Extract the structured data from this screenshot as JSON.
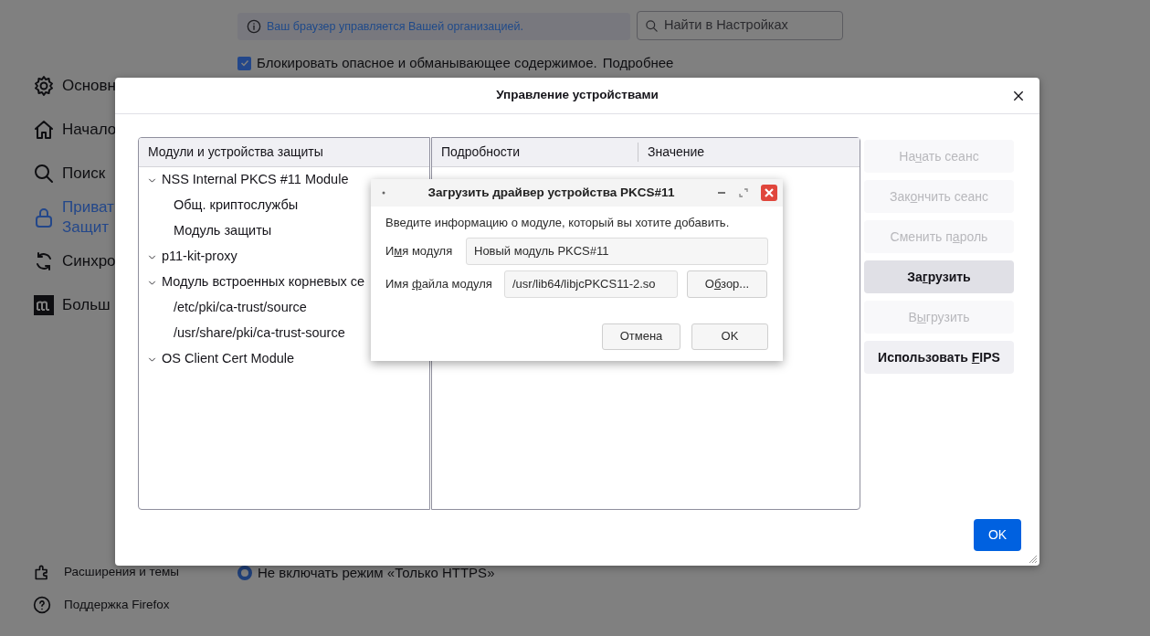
{
  "settings_page": {
    "sidebar": {
      "items": [
        {
          "lines": [
            "Основн"
          ],
          "selected": false
        },
        {
          "lines": [
            "Начало"
          ],
          "selected": false
        },
        {
          "lines": [
            "Поиск"
          ],
          "selected": false
        },
        {
          "lines": [
            "Приват",
            "Защит"
          ],
          "selected": true
        },
        {
          "lines": [
            "Синхро"
          ],
          "selected": false
        },
        {
          "lines": [
            "Больш"
          ],
          "selected": false
        }
      ],
      "footer": [
        {
          "label": "Расширения и темы"
        },
        {
          "label": "Поддержка Firefox"
        }
      ]
    },
    "policy_notice": "Ваш браузер управляется Вашей организацией.",
    "search": {
      "placeholder": "Найти в Настройках"
    },
    "block_option": {
      "checked": true,
      "label": "Блокировать опасное и обманывающее содержимое.",
      "link": "Подробнее"
    },
    "https_option": {
      "selected": true,
      "label": "Не включать режим «Только HTTPS»"
    }
  },
  "device_manager": {
    "title": "Управление устройствами",
    "tree_header": "Модули и устройства защиты",
    "modules": [
      {
        "label": "NSS Internal PKCS #11 Module",
        "expanded": true,
        "children": [
          {
            "label": "Общ. криптослужбы"
          },
          {
            "label": "Модуль защиты"
          }
        ]
      },
      {
        "label": "p11-kit-proxy",
        "expanded": true
      },
      {
        "label": "Модуль встроенных корневых се",
        "expanded": true,
        "children": [
          {
            "label": "/etc/pki/ca-trust/source"
          },
          {
            "label": "/usr/share/pki/ca-trust-source"
          }
        ]
      },
      {
        "label": "OS Client Cert Module",
        "expanded": true
      }
    ],
    "details_columns": [
      "Подробности",
      "Значение"
    ],
    "actions": [
      {
        "label_parts": [
          "На",
          "ч",
          "ать сеанс"
        ],
        "disabled": true,
        "hovered": false
      },
      {
        "label_parts": [
          "Зак",
          "о",
          "нчить сеанс"
        ],
        "disabled": true,
        "hovered": false
      },
      {
        "label_parts": [
          "Сменить п",
          "а",
          "роль"
        ],
        "disabled": true,
        "hovered": false
      },
      {
        "label_parts": [
          "За",
          "г",
          "рузить"
        ],
        "disabled": false,
        "hovered": true
      },
      {
        "label_parts": [
          "В",
          "ы",
          "грузить"
        ],
        "disabled": true,
        "hovered": false
      },
      {
        "label_parts": [
          "Использовать ",
          "F",
          "IPS"
        ],
        "disabled": false,
        "hovered": false
      }
    ],
    "ok": "OK"
  },
  "load_dialog": {
    "title": "Загрузить драйвер устройства PKCS#11",
    "description": "Введите информацию о модуле, который вы хотите добавить.",
    "fields": [
      {
        "label_parts": [
          "И",
          "м",
          "я модуля"
        ],
        "value": "Новый модуль PKCS#11"
      },
      {
        "label_parts": [
          "Имя ",
          "ф",
          "айла модуля"
        ],
        "value": "/usr/lib64/libjcPKCS11-2.so",
        "browse_parts": [
          "О",
          "б",
          "зор..."
        ]
      }
    ],
    "cancel": "Отмена",
    "ok": "OK"
  }
}
